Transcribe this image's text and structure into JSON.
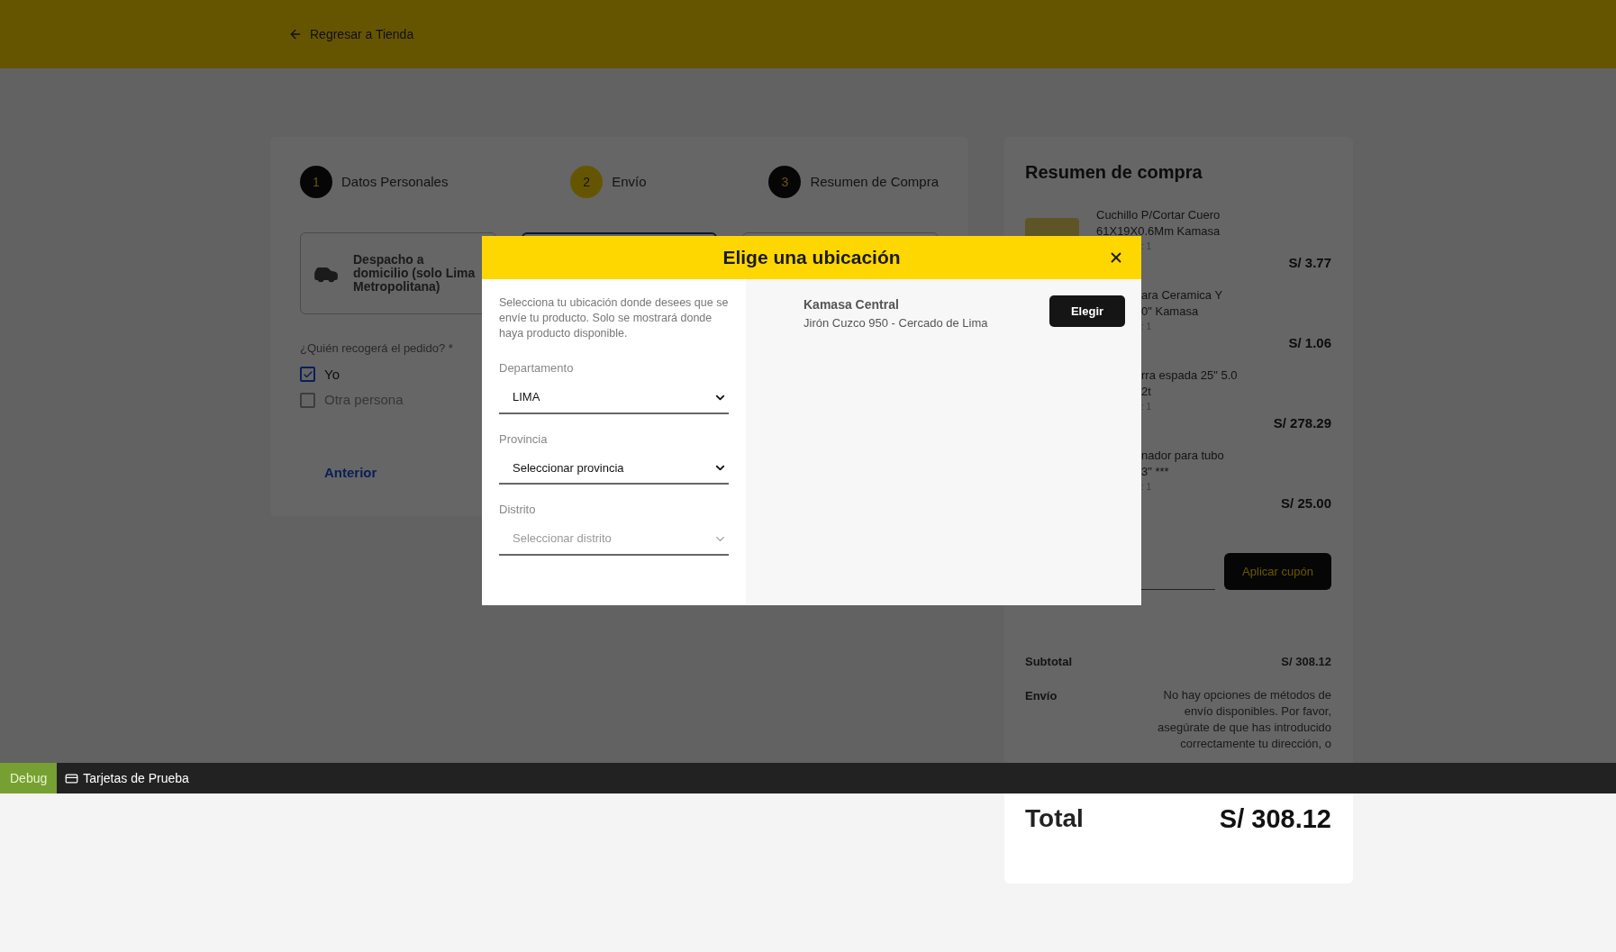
{
  "header": {
    "back_link": "Regresar a Tienda"
  },
  "steps": [
    {
      "number": "1",
      "label": "Datos Personales",
      "selected": false
    },
    {
      "number": "2",
      "label": "Envío",
      "selected": true
    },
    {
      "number": "3",
      "label": "Resumen de Compra",
      "selected": false
    }
  ],
  "delivery_options": [
    {
      "label": "Despacho a domicilio (solo Lima Metropolitana)",
      "selected": false
    },
    {
      "selected": true
    },
    {
      "selected": false
    }
  ],
  "pickup": {
    "question": "¿Quién recogerá el pedido? *",
    "options": [
      {
        "label": "Yo",
        "checked": true
      },
      {
        "label": "Otra persona",
        "checked": false
      }
    ]
  },
  "back_button": "Anterior",
  "summary": {
    "title": "Resumen de compra",
    "items": [
      {
        "name_lines": [
          "Cuchillo P/Cortar Cuero",
          "61X19X0.6Mm Kamasa"
        ],
        "quantity": ": 1",
        "price": "S/ 3.77"
      },
      {
        "name_lines": [
          "ara Ceramica Y",
          "0\" Kamasa"
        ],
        "quantity": ": 1",
        "price": "S/ 1.06"
      },
      {
        "name_lines": [
          "rra espada 25\" 5.0",
          "2t"
        ],
        "quantity": ": 1",
        "price": "S/ 278.29"
      },
      {
        "name_lines": [
          "nador para tubo",
          "3\" ***"
        ],
        "quantity": ": 1",
        "price": "S/ 25.00"
      }
    ],
    "coupon_button": "Aplicar cupón",
    "subtotal_label": "Subtotal",
    "subtotal": "S/ 308.12",
    "shipping_label": "Envío",
    "shipping_note": "No hay opciones de métodos de envío disponibles. Por favor, asegúrate de que has introducido correctamente tu dirección, o",
    "total_label": "Total",
    "total": "S/ 308.12"
  },
  "modal": {
    "title": "Elige una ubicación",
    "description": "Selecciona tu ubicación donde desees que se envíe tu producto. Solo se mostrará donde haya producto disponible.",
    "fields": [
      {
        "label": "Departamento",
        "value": "LIMA",
        "disabled": false
      },
      {
        "label": "Provincia",
        "value": "Seleccionar provincia",
        "disabled": false
      },
      {
        "label": "Distrito",
        "placeholder": "Seleccionar distrito",
        "disabled": true
      }
    ],
    "store": {
      "name": "Kamasa Central",
      "address": "Jirón Cuzco 950 - Cercado de Lima",
      "button": "Elegir"
    }
  },
  "debug_bar": {
    "badge": "Debug",
    "link": "Tarjetas de Prueba"
  }
}
